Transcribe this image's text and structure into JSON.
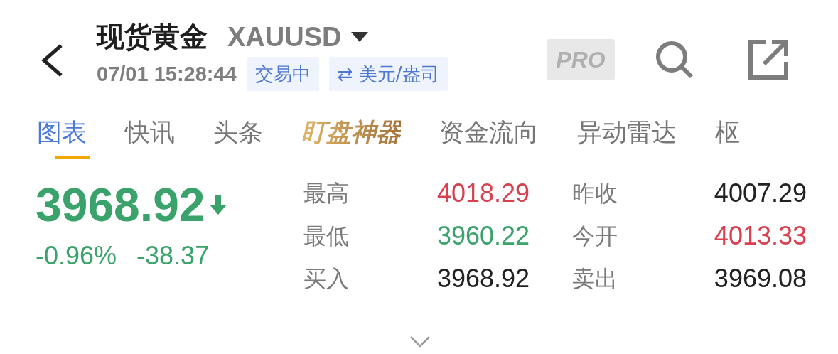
{
  "header": {
    "title": "现货黄金",
    "symbol": "XAUUSD",
    "time": "07/01 15:28:44",
    "status_badge": "交易中",
    "unit_badge": "⇄ 美元/盎司",
    "pro_badge": "PRO"
  },
  "tabs": [
    {
      "label": "图表",
      "selected": true,
      "kind": "plain"
    },
    {
      "label": "快讯",
      "selected": false,
      "kind": "plain"
    },
    {
      "label": "头条",
      "selected": false,
      "kind": "plain"
    },
    {
      "label": "盯盘神器",
      "selected": false,
      "kind": "special"
    },
    {
      "label": "资金流向",
      "selected": false,
      "kind": "plain"
    },
    {
      "label": "异动雷达",
      "selected": false,
      "kind": "plain"
    },
    {
      "label": "枢",
      "selected": false,
      "kind": "plain"
    }
  ],
  "quote": {
    "price": "3968.92",
    "falling": true,
    "color": "#3aa36b",
    "change_percent": "-0.96%",
    "change": "-38.37"
  },
  "stats": [
    {
      "label": "最高",
      "value": "4018.29",
      "color": "#d9404f"
    },
    {
      "label": "昨收",
      "value": "4007.29",
      "color": "#222222"
    },
    {
      "label": "最低",
      "value": "3960.22",
      "color": "#3aa36b"
    },
    {
      "label": "今开",
      "value": "4013.33",
      "color": "#d9404f"
    },
    {
      "label": "买入",
      "value": "3968.92",
      "color": "#222222"
    },
    {
      "label": "卖出",
      "value": "3969.08",
      "color": "#222222"
    }
  ]
}
